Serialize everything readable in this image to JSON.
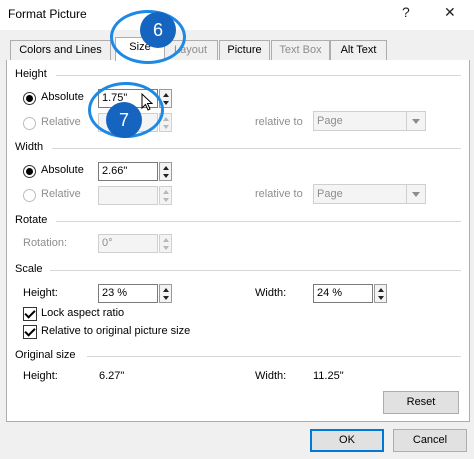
{
  "window": {
    "title": "Format Picture",
    "help": "?",
    "close": "✕"
  },
  "tabs": [
    {
      "label": "Colors and Lines"
    },
    {
      "label": "Size"
    },
    {
      "label": "Layout"
    },
    {
      "label": "Picture"
    },
    {
      "label": "Text Box"
    },
    {
      "label": "Alt Text"
    }
  ],
  "height_section": {
    "title": "Height",
    "absolute_label": "Absolute",
    "absolute_value": "1.75\"",
    "relative_label": "Relative",
    "relative_to_label": "relative to",
    "relative_to_value": "Page"
  },
  "width_section": {
    "title": "Width",
    "absolute_label": "Absolute",
    "absolute_value": "2.66\"",
    "relative_label": "Relative",
    "relative_to_label": "relative to",
    "relative_to_value": "Page"
  },
  "rotate_section": {
    "title": "Rotate",
    "rotation_label": "Rotation:",
    "rotation_value": "0°"
  },
  "scale_section": {
    "title": "Scale",
    "height_label": "Height:",
    "height_value": "23 %",
    "width_label": "Width:",
    "width_value": "24 %",
    "lock_aspect": "Lock aspect ratio",
    "relative_original": "Relative to original picture size"
  },
  "original_size": {
    "title": "Original size",
    "height_label": "Height:",
    "height_value": "6.27\"",
    "width_label": "Width:",
    "width_value": "11.25\""
  },
  "buttons": {
    "reset": "Reset",
    "ok": "OK",
    "cancel": "Cancel"
  },
  "callouts": {
    "six": "6",
    "seven": "7"
  },
  "colors": {
    "accent": "#0078d7",
    "callout": "#1565c0"
  }
}
